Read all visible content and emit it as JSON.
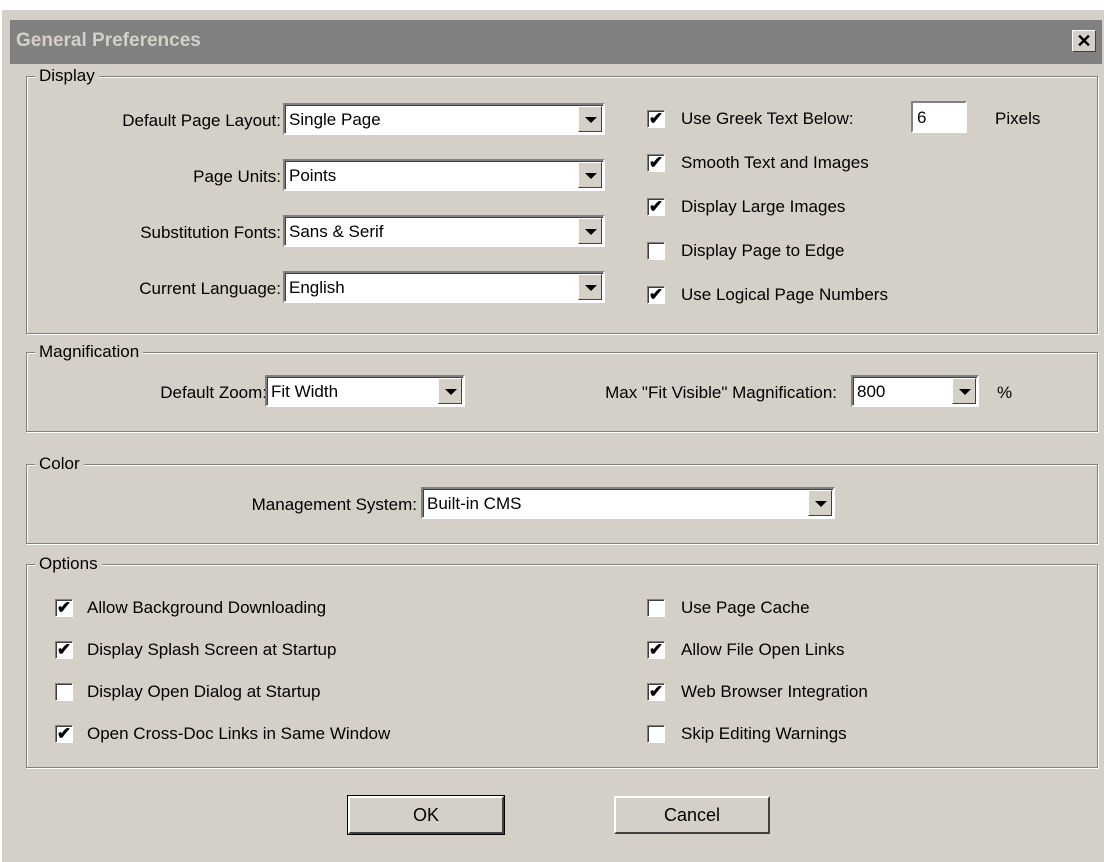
{
  "window": {
    "title": "General Preferences",
    "close_glyph": "✕"
  },
  "display": {
    "legend": "Display",
    "page_layout": {
      "label": "Default Page Layout:",
      "value": "Single Page"
    },
    "page_units": {
      "label": "Page Units:",
      "value": "Points"
    },
    "subst_fonts": {
      "label": "Substitution Fonts:",
      "value": "Sans & Serif"
    },
    "language": {
      "label": "Current Language:",
      "value": "English"
    },
    "greek": {
      "label": "Use Greek Text Below:",
      "value": "6",
      "unit": "Pixels",
      "checked": true
    },
    "smooth": {
      "label": "Smooth Text and Images",
      "checked": true
    },
    "large_images": {
      "label": "Display Large Images",
      "checked": true
    },
    "page_edge": {
      "label": "Display Page to Edge",
      "checked": false
    },
    "logical_nums": {
      "label": "Use Logical Page Numbers",
      "checked": true
    }
  },
  "magnification": {
    "legend": "Magnification",
    "zoom": {
      "label": "Default Zoom:",
      "value": "Fit Width"
    },
    "fit_visible": {
      "label": "Max \"Fit Visible\" Magnification:",
      "value": "800",
      "unit": "%"
    }
  },
  "color": {
    "legend": "Color",
    "cms": {
      "label": "Management System:",
      "value": "Built-in CMS"
    }
  },
  "options": {
    "legend": "Options",
    "bg_download": {
      "label": "Allow Background Downloading",
      "checked": true
    },
    "splash": {
      "label": "Display Splash Screen at Startup",
      "checked": true
    },
    "open_dialog": {
      "label": "Display Open Dialog at Startup",
      "checked": false
    },
    "cross_doc": {
      "label": "Open Cross-Doc Links in Same Window",
      "checked": true
    },
    "page_cache": {
      "label": "Use Page Cache",
      "checked": false
    },
    "file_open": {
      "label": "Allow File Open Links",
      "checked": true
    },
    "web_browser": {
      "label": "Web Browser Integration",
      "checked": true
    },
    "skip_warn": {
      "label": "Skip Editing Warnings",
      "checked": false
    }
  },
  "buttons": {
    "ok": "OK",
    "cancel": "Cancel"
  },
  "check_glyph": "✔"
}
